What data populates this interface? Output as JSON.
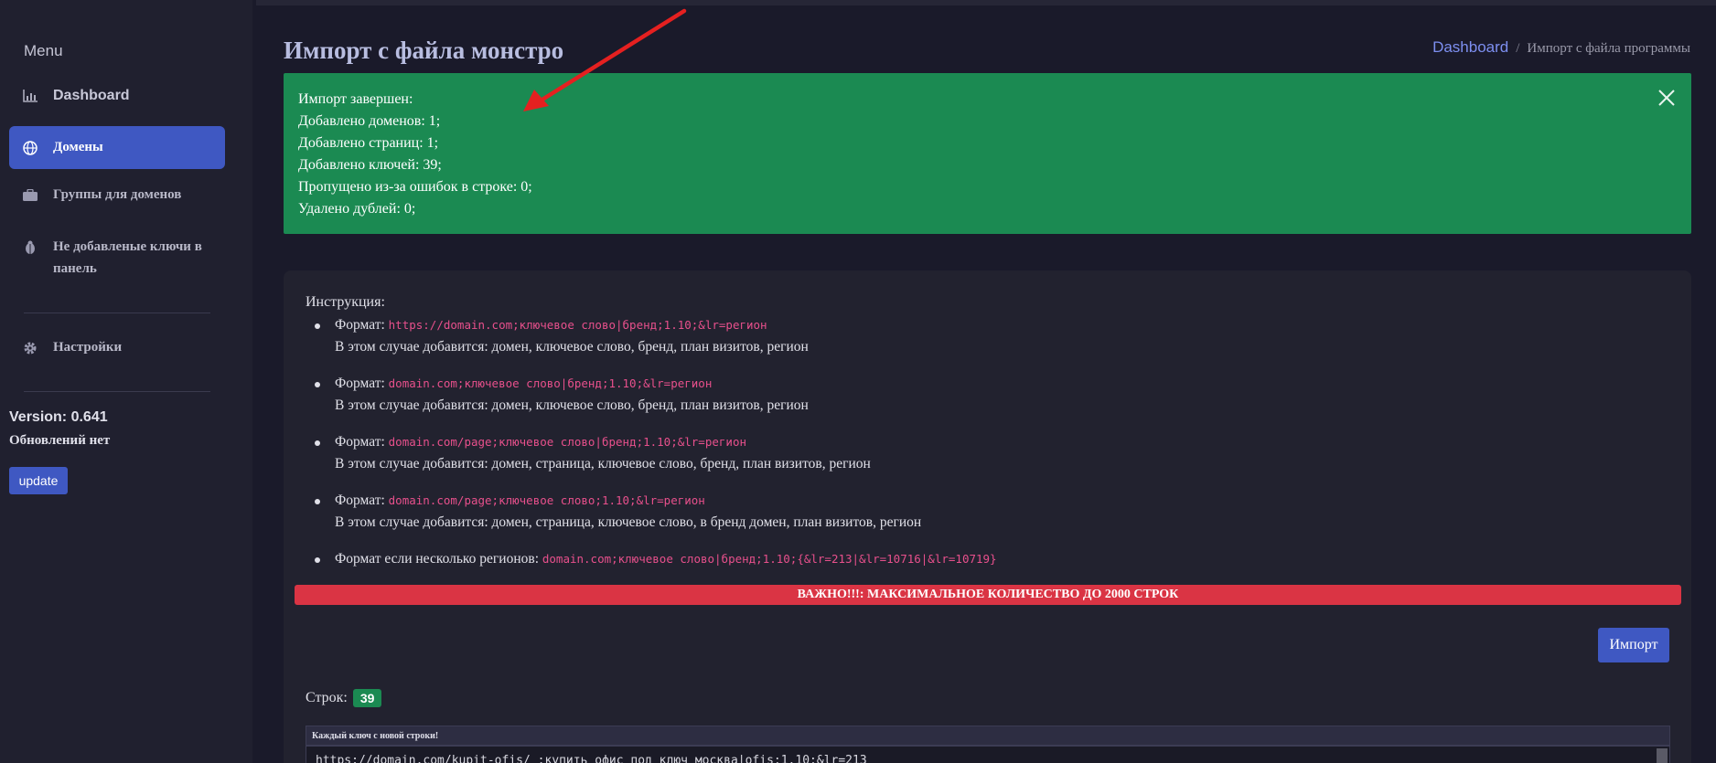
{
  "sidebar": {
    "menu_title": "Menu",
    "items": [
      {
        "label": "Dashboard",
        "icon": "chart-icon"
      },
      {
        "label": "Домены",
        "icon": "globe-icon"
      },
      {
        "label": "Группы для доменов",
        "icon": "briefcase-icon"
      },
      {
        "label": "Не добавленые ключи в панель",
        "icon": "bug-icon"
      },
      {
        "label": "Настройки",
        "icon": "gear-icon"
      }
    ],
    "version": "Version: 0.641",
    "updates_status": "Обновлений нет",
    "update_button": "update"
  },
  "header": {
    "title": "Импорт с файла монстро",
    "breadcrumb": {
      "link": "Dashboard",
      "separator": "/",
      "current": "Импорт с файла программы"
    }
  },
  "alert": {
    "lines": [
      "Импорт завершен:",
      "Добавлено доменов: 1;",
      "Добавлено страниц: 1;",
      "Добавлено ключей: 39;",
      "Пропущено из-за ошибок в строке: 0;",
      "Удалено дублей: 0;"
    ],
    "color": "#1b8a52"
  },
  "instructions": {
    "title": "Инструкция:",
    "format_label": "Формат:",
    "items": [
      {
        "code": "https://domain.com;ключевое слово|бренд;1.10;&lr=регион",
        "desc": "В этом случае добавится: домен, ключевое слово, бренд, план визитов, регион"
      },
      {
        "code": "domain.com;ключевое слово|бренд;1.10;&lr=регион",
        "desc": "В этом случае добавится: домен, ключевое слово, бренд, план визитов, регион"
      },
      {
        "code": "domain.com/page;ключевое слово|бренд;1.10;&lr=регион",
        "desc": "В этом случае добавится: домен, страница, ключевое слово, бренд, план визитов, регион"
      },
      {
        "code": "domain.com/page;ключевое слово;1.10;&lr=регион",
        "desc": "В этом случае добавится: домен, страница, ключевое слово, в бренд домен, план визитов, регион"
      }
    ],
    "multi_region_label": "Формат если несколько регионов:",
    "multi_region_code": "domain.com;ключевое слово|бренд;1.10;{&lr=213|&lr=10716|&lr=10719}"
  },
  "warning": "ВАЖНО!!!: МАКСИМАЛЬНОЕ КОЛИЧЕСТВО ДО 2000 СТРОК",
  "import_button": "Импорт",
  "rows": {
    "label": "Строк:",
    "count": "39"
  },
  "textarea": {
    "header": "Каждый ключ с новой строки!",
    "first_line": "https://domain.com/kupit-ofis/ ;купить офис под ключ москва|ofis;1.10;&lr=213"
  },
  "colors": {
    "accent": "#3f58c2",
    "success": "#1b8a52",
    "danger": "#da3444",
    "code": "#e8508c"
  }
}
